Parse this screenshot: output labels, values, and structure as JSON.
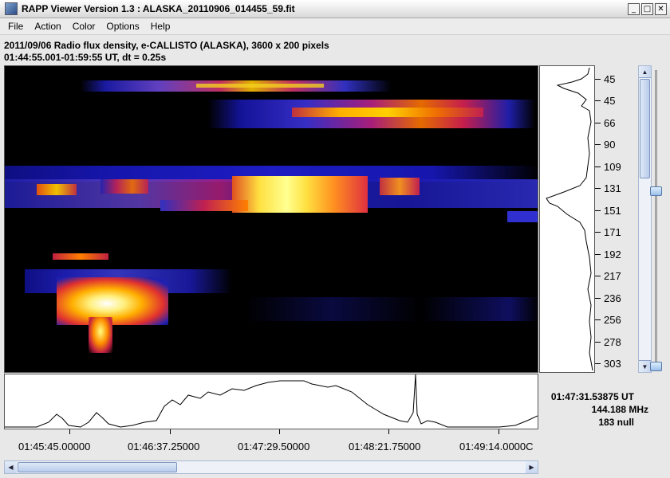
{
  "window": {
    "title": "RAPP Viewer Version 1.3 : ALASKA_20110906_014455_59.fit",
    "controls": {
      "minimize": "_",
      "maximize": "□",
      "close": "✕"
    }
  },
  "menu": [
    "File",
    "Action",
    "Color",
    "Options",
    "Help"
  ],
  "info": {
    "line1": "2011/09/06  Radio flux density, e-CALLISTO (ALASKA),  3600 x 200 pixels",
    "line2": "01:44:55.001-01:59:55 UT,  dt = 0.25s"
  },
  "frequency_axis": {
    "ticks": [
      "45",
      "45",
      "66",
      "90",
      "109",
      "131",
      "151",
      "171",
      "192",
      "217",
      "236",
      "256",
      "278",
      "303"
    ]
  },
  "readout": {
    "time": "01:47:31.53875 UT",
    "frequency": "144.188 MHz",
    "value": "183 null"
  },
  "time_axis": {
    "ticks": [
      "01:45:45.00000",
      "01:46:37.25000",
      "01:47:29.50000",
      "01:48:21.75000",
      "01:49:14.0000C"
    ]
  },
  "icons": {
    "app": "java-cup-icon",
    "scroll_up": "arrow-up-icon",
    "scroll_down": "arrow-down-icon",
    "scroll_left": "arrow-left-icon",
    "scroll_right": "arrow-right-icon"
  }
}
